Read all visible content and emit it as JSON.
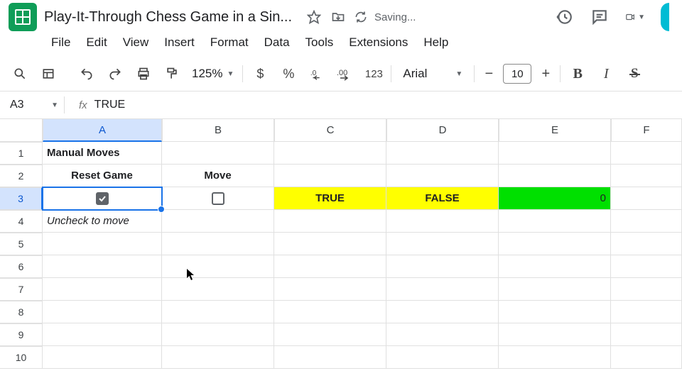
{
  "app": {
    "doc_title": "Play-It-Through Chess Game in a Sin...",
    "saving": "Saving..."
  },
  "menus": [
    "File",
    "Edit",
    "View",
    "Insert",
    "Format",
    "Data",
    "Tools",
    "Extensions",
    "Help"
  ],
  "toolbar": {
    "zoom": "125%",
    "font_name": "Arial",
    "font_size": "10",
    "currency": "$",
    "percent": "%",
    "num_fmt": "123"
  },
  "namebox": {
    "ref": "A3",
    "formula": "TRUE"
  },
  "columns": [
    "A",
    "B",
    "C",
    "D",
    "E",
    "F"
  ],
  "selected_col": "A",
  "rows": [
    "1",
    "2",
    "3",
    "4",
    "5",
    "6",
    "7",
    "8",
    "9",
    "10"
  ],
  "selected_row": "3",
  "cells": {
    "A1": "Manual Moves",
    "A2": "Reset Game",
    "B2": "Move",
    "A3_checked": true,
    "B3_checked": false,
    "C3": "TRUE",
    "D3": "FALSE",
    "E3": "0",
    "A4": "Uncheck to move"
  }
}
